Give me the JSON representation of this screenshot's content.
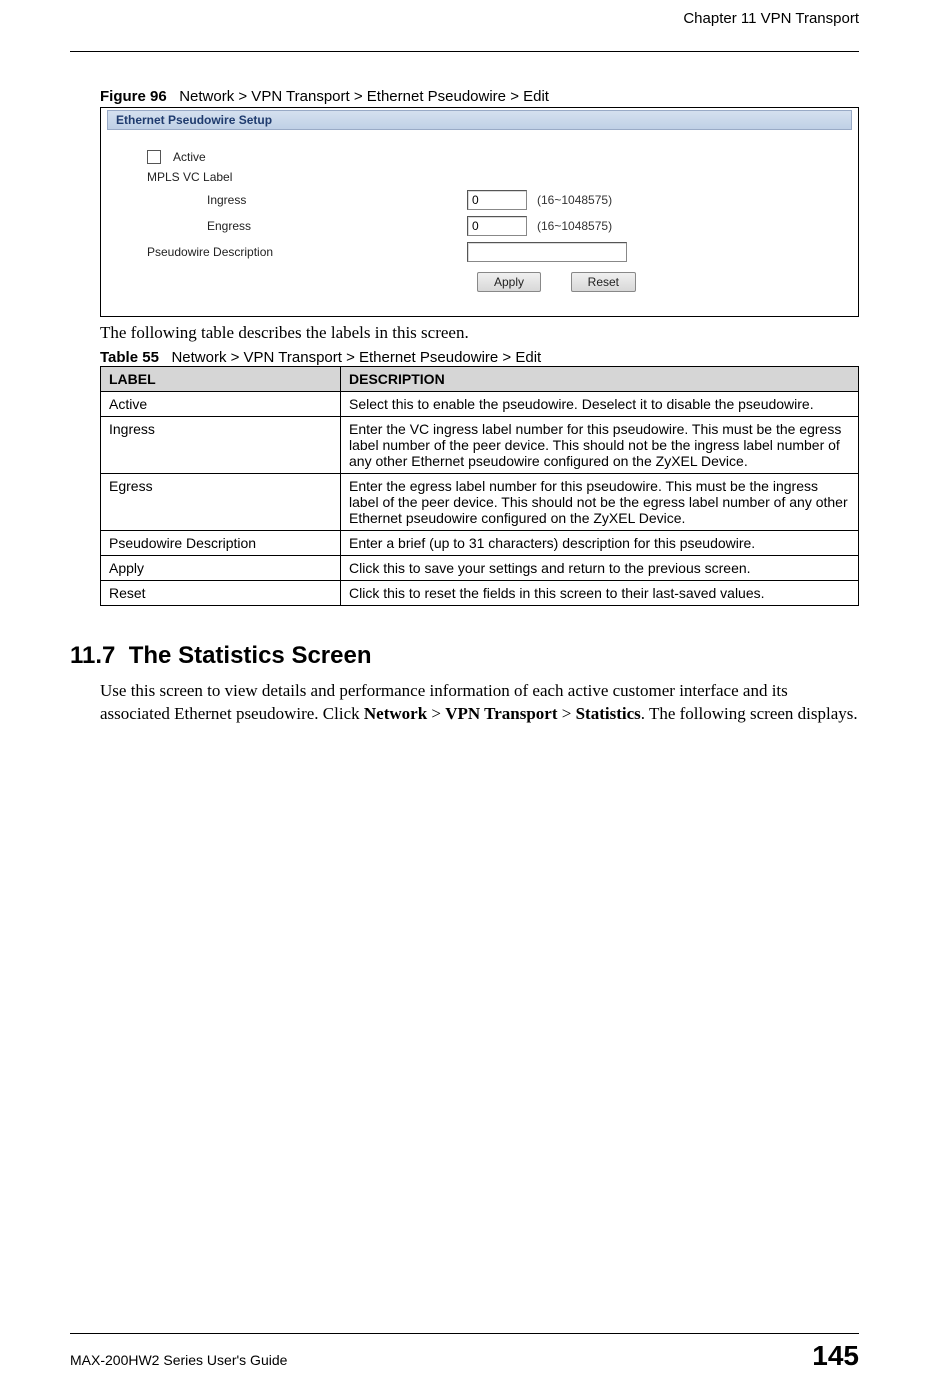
{
  "header": {
    "chapter": "Chapter 11 VPN Transport"
  },
  "figure": {
    "label": "Figure 96",
    "caption": "Network > VPN Transport > Ethernet Pseudowire > Edit",
    "panel_title": "Ethernet Pseudowire Setup",
    "active_label": "Active",
    "mpls_label": "MPLS VC Label",
    "ingress_label": "Ingress",
    "egress_label": "Engress",
    "ingress_value": "0",
    "egress_value": "0",
    "ingress_hint": "(16~1048575)",
    "egress_hint": "(16~1048575)",
    "desc_label": "Pseudowire Description",
    "desc_value": "",
    "apply_btn": "Apply",
    "reset_btn": "Reset"
  },
  "intro_text": "The following table describes the labels in this screen.",
  "table": {
    "label": "Table 55",
    "caption": "Network > VPN Transport > Ethernet Pseudowire > Edit",
    "col_label": "LABEL",
    "col_desc": "DESCRIPTION",
    "rows": [
      {
        "label": "Active",
        "desc": "Select this to enable the pseudowire. Deselect it to disable the pseudowire."
      },
      {
        "label": "Ingress",
        "desc": "Enter the VC ingress label number for this pseudowire. This must be the egress label number of the peer device. This should not be the ingress label number of any other Ethernet pseudowire configured on the ZyXEL Device."
      },
      {
        "label": "Egress",
        "desc": "Enter the egress label number for this pseudowire. This must be the ingress label of the peer device. This should not be the egress label number of any other Ethernet pseudowire configured on the ZyXEL Device."
      },
      {
        "label": "Pseudowire Description",
        "desc": "Enter a brief (up to 31 characters) description for this pseudowire."
      },
      {
        "label": "Apply",
        "desc": "Click this to save your settings and return to the previous screen."
      },
      {
        "label": "Reset",
        "desc": "Click this to reset the fields in this screen to their last-saved values."
      }
    ]
  },
  "section": {
    "number": "11.7",
    "title": "The Statistics Screen",
    "para_pre": "Use this screen to view details and performance information of each active customer interface and its associated Ethernet pseudowire. Click ",
    "b1": "Network",
    "gt1": " > ",
    "b2": "VPN Transport",
    "gt2": " > ",
    "b3": "Statistics",
    "para_post": ". The following screen displays."
  },
  "footer": {
    "guide": "MAX-200HW2 Series User's Guide",
    "page": "145"
  }
}
